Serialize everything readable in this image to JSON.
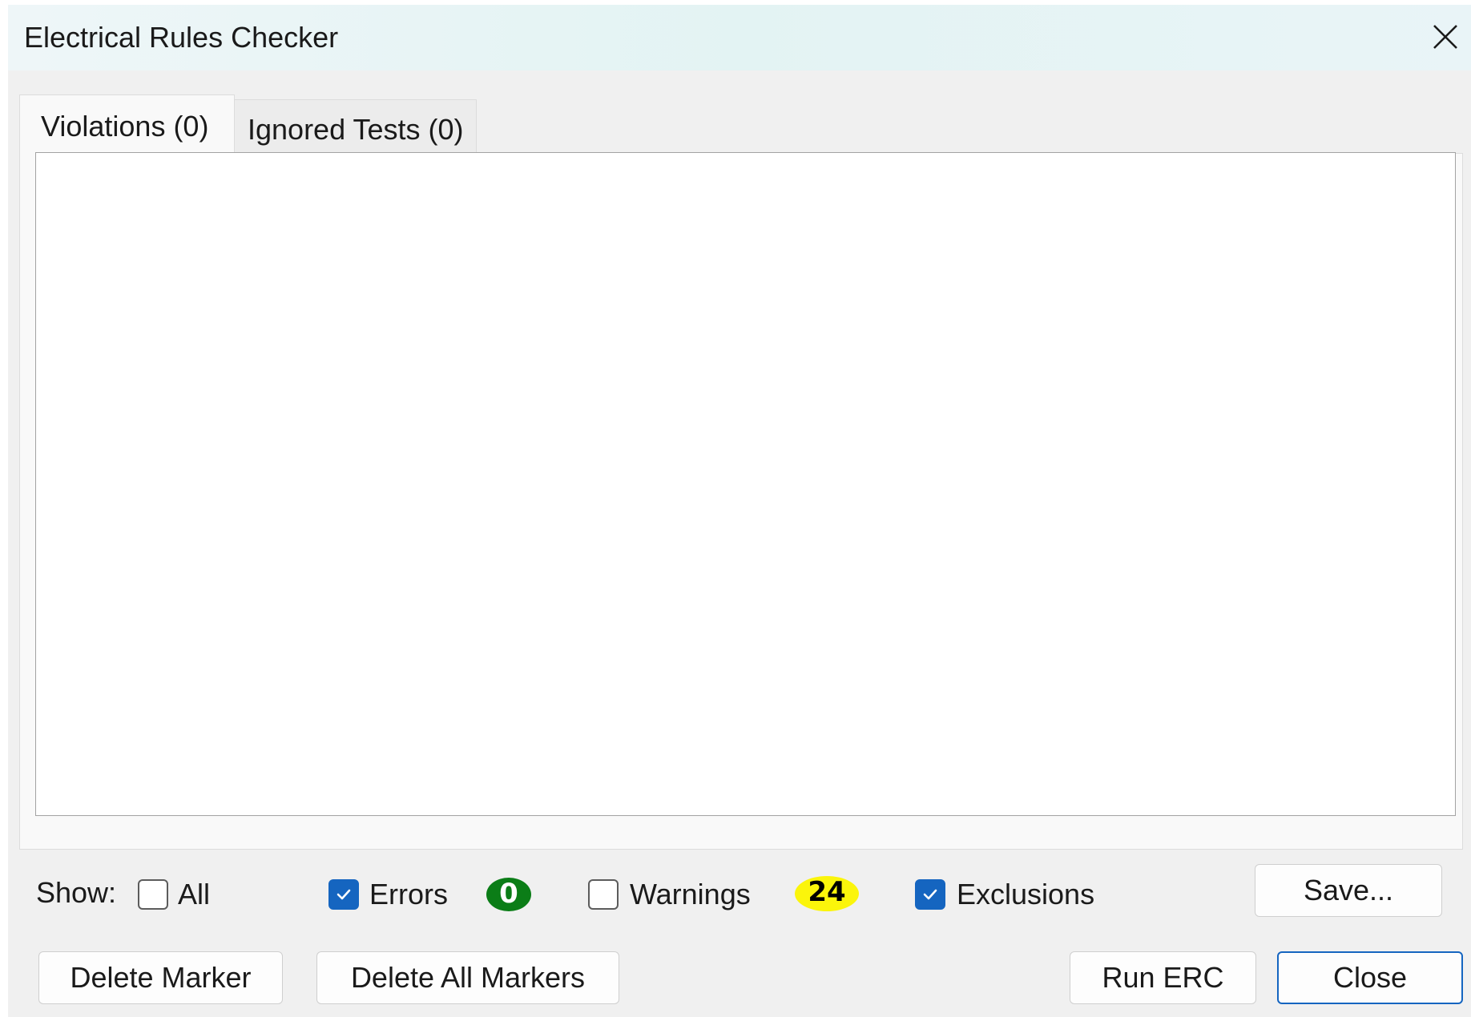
{
  "window": {
    "title": "Electrical Rules Checker",
    "close_icon": "close-icon"
  },
  "tabs": [
    {
      "label": "Violations (0)",
      "selected": true
    },
    {
      "label": "Ignored Tests (0)",
      "selected": false
    }
  ],
  "filters": {
    "show_label": "Show:",
    "all": {
      "label": "All",
      "checked": false
    },
    "errors": {
      "label": "Errors",
      "checked": true,
      "count": "0"
    },
    "warnings": {
      "label": "Warnings",
      "checked": false,
      "count": "24"
    },
    "exclusions": {
      "label": "Exclusions",
      "checked": true
    }
  },
  "buttons": {
    "save": "Save...",
    "delete_marker": "Delete Marker",
    "delete_all_markers": "Delete All Markers",
    "run_erc": "Run ERC",
    "close": "Close"
  },
  "colors": {
    "accent": "#1565c0",
    "errors_badge": "#0b7d17",
    "warnings_badge": "#fbf50b"
  }
}
